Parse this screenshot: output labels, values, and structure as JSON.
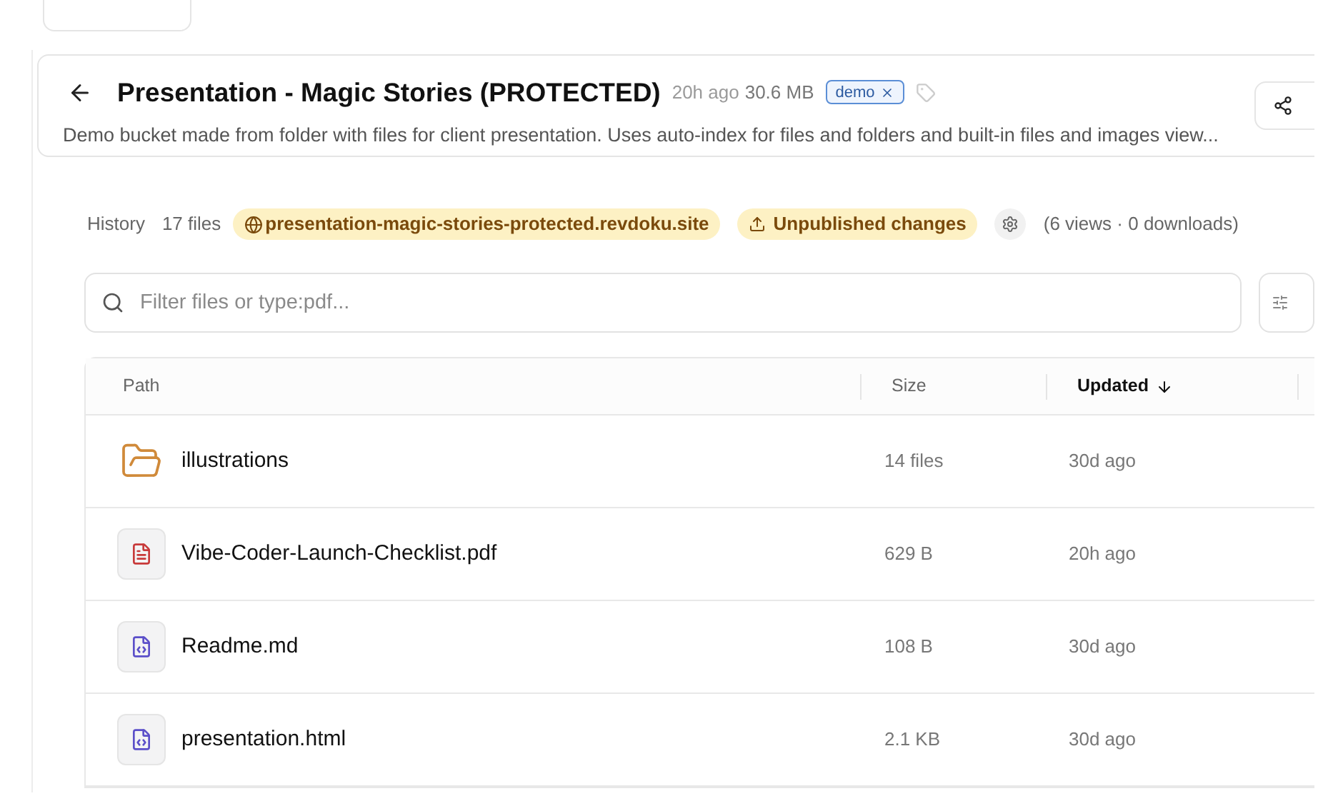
{
  "header": {
    "title": "Presentation - Magic Stories (PROTECTED)",
    "age": "20h ago",
    "size": "30.6 MB",
    "tags": [
      "demo"
    ],
    "description": "Demo bucket made from folder with files for client presentation. Uses auto-index for files and folders and built-in files and images view..."
  },
  "meta": {
    "history": "History",
    "files": "17 files",
    "domain": "presentation-magic-stories-protected.revdoku.site",
    "unpublished": "Unpublished changes",
    "stats": "(6 views · 0 downloads)"
  },
  "search": {
    "placeholder": "Filter files or type:pdf..."
  },
  "table": {
    "columns": [
      {
        "label": "Path",
        "sorted": false
      },
      {
        "label": "Size",
        "sorted": false
      },
      {
        "label": "Updated",
        "sorted": true
      }
    ],
    "rows": [
      {
        "kind": "folder",
        "name": "illustrations",
        "size": "14 files",
        "updated": "30d ago"
      },
      {
        "kind": "pdf",
        "name": "Vibe-Coder-Launch-Checklist.pdf",
        "size": "629 B",
        "updated": "20h ago"
      },
      {
        "kind": "code",
        "name": "Readme.md",
        "size": "108 B",
        "updated": "30d ago"
      },
      {
        "kind": "code",
        "name": "presentation.html",
        "size": "2.1 KB",
        "updated": "30d ago"
      }
    ]
  }
}
